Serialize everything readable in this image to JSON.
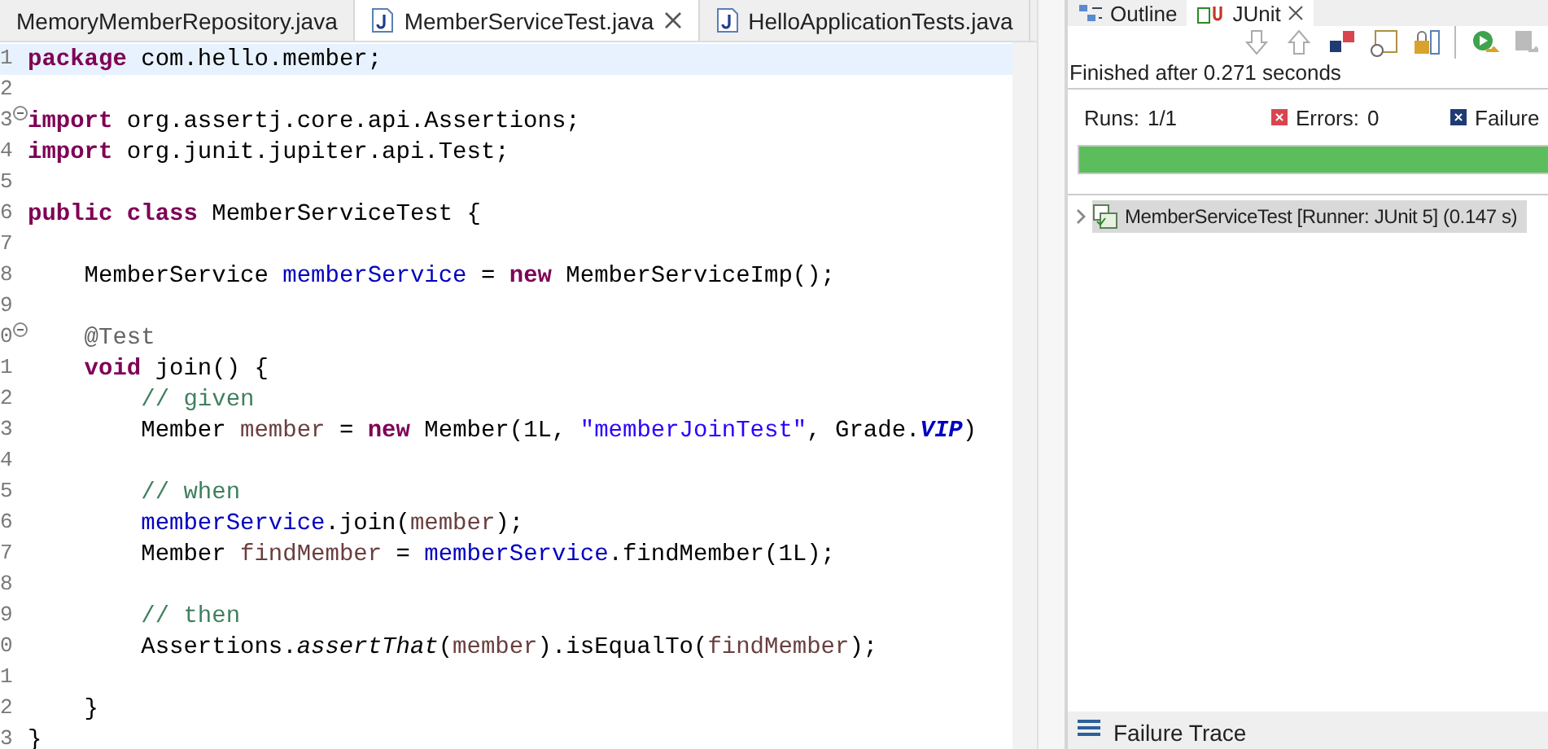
{
  "editor_tabs": [
    {
      "label": "MemoryMemberRepository.java",
      "selected": false,
      "closable": false,
      "icon": false
    },
    {
      "label": "MemberServiceTest.java",
      "selected": true,
      "closable": true,
      "icon": true
    },
    {
      "label": "HelloApplicationTests.java",
      "selected": false,
      "closable": false,
      "icon": true
    }
  ],
  "editor": {
    "lines": [
      {
        "number": "1",
        "fold": false,
        "current": true,
        "segments": [
          {
            "kind": "keyword",
            "text": "package"
          },
          {
            "kind": "plain",
            "text": " com.hello.member;"
          }
        ]
      },
      {
        "number": "2",
        "fold": false,
        "current": false
      },
      {
        "number": "3",
        "fold": true,
        "current": false,
        "segments": [
          {
            "kind": "keyword",
            "text": "import"
          },
          {
            "kind": "plain",
            "text": " org.assertj.core.api.Assertions;"
          }
        ]
      },
      {
        "number": "4",
        "fold": false,
        "current": false,
        "segments": [
          {
            "kind": "keyword",
            "text": "import"
          },
          {
            "kind": "plain",
            "text": " org.junit.jupiter.api.Test;"
          }
        ]
      },
      {
        "number": "5",
        "fold": false,
        "current": false
      },
      {
        "number": "6",
        "fold": false,
        "current": false,
        "segments": [
          {
            "kind": "keyword",
            "text": "public"
          },
          {
            "kind": "keyword",
            "text": " class"
          },
          {
            "kind": "plain",
            "text": " MemberServiceTest {"
          }
        ]
      },
      {
        "number": "7",
        "fold": false,
        "current": false
      },
      {
        "number": "8",
        "fold": false,
        "current": false,
        "segments": [
          {
            "kind": "plain",
            "text": "    MemberService "
          },
          {
            "kind": "field",
            "text": "memberService"
          },
          {
            "kind": "plain",
            "text": " = "
          },
          {
            "kind": "keyword",
            "text": "new"
          },
          {
            "kind": "plain",
            "text": " MemberServiceImp();"
          }
        ]
      },
      {
        "number": "9",
        "fold": false,
        "current": false
      },
      {
        "number": "0",
        "fold": true,
        "current": false,
        "segments": [
          {
            "kind": "annotation",
            "text": "    @Test"
          }
        ]
      },
      {
        "number": "1",
        "fold": false,
        "current": false,
        "segments": [
          {
            "kind": "keyword",
            "text": "    void"
          },
          {
            "kind": "plain",
            "text": " join() {"
          }
        ]
      },
      {
        "number": "2",
        "fold": false,
        "current": false,
        "segments": [
          {
            "kind": "comment",
            "text": "        // given"
          }
        ]
      },
      {
        "number": "3",
        "fold": false,
        "current": false,
        "segments": [
          {
            "kind": "plain",
            "text": "        Member "
          },
          {
            "kind": "local",
            "text": "member"
          },
          {
            "kind": "plain",
            "text": " = "
          },
          {
            "kind": "keyword",
            "text": "new"
          },
          {
            "kind": "plain",
            "text": " Member(1L, "
          },
          {
            "kind": "string",
            "text": "\"memberJoinTest\""
          },
          {
            "kind": "plain",
            "text": ", Grade."
          },
          {
            "kind": "constant",
            "text": "VIP"
          },
          {
            "kind": "plain",
            "text": ")"
          }
        ]
      },
      {
        "number": "4",
        "fold": false,
        "current": false
      },
      {
        "number": "5",
        "fold": false,
        "current": false,
        "segments": [
          {
            "kind": "comment",
            "text": "        // when"
          }
        ]
      },
      {
        "number": "6",
        "fold": false,
        "current": false,
        "segments": [
          {
            "kind": "field",
            "text": "        memberService"
          },
          {
            "kind": "plain",
            "text": ".join("
          },
          {
            "kind": "local",
            "text": "member"
          },
          {
            "kind": "plain",
            "text": ");"
          }
        ]
      },
      {
        "number": "7",
        "fold": false,
        "current": false,
        "segments": [
          {
            "kind": "plain",
            "text": "        Member "
          },
          {
            "kind": "local",
            "text": "findMember"
          },
          {
            "kind": "plain",
            "text": " = "
          },
          {
            "kind": "field",
            "text": "memberService"
          },
          {
            "kind": "plain",
            "text": ".findMember(1L);"
          }
        ]
      },
      {
        "number": "8",
        "fold": false,
        "current": false
      },
      {
        "number": "9",
        "fold": false,
        "current": false,
        "segments": [
          {
            "kind": "comment",
            "text": "        // then"
          }
        ]
      },
      {
        "number": "0",
        "fold": false,
        "current": false,
        "segments": [
          {
            "kind": "plain",
            "text": "        Assertions."
          },
          {
            "kind": "static",
            "text": "assertThat"
          },
          {
            "kind": "plain",
            "text": "("
          },
          {
            "kind": "local",
            "text": "member"
          },
          {
            "kind": "plain",
            "text": ").isEqualTo("
          },
          {
            "kind": "local",
            "text": "findMember"
          },
          {
            "kind": "plain",
            "text": ");"
          }
        ]
      },
      {
        "number": "1",
        "fold": false,
        "current": false
      },
      {
        "number": "2",
        "fold": false,
        "current": false,
        "segments": [
          {
            "kind": "plain",
            "text": "    }"
          }
        ]
      },
      {
        "number": "3",
        "fold": false,
        "current": false,
        "segments": [
          {
            "kind": "plain",
            "text": "}"
          }
        ]
      }
    ]
  },
  "junit": {
    "view_tabs": [
      {
        "label": "Outline",
        "selected": false,
        "kind": "outline"
      },
      {
        "label": "JUnit",
        "selected": true,
        "kind": "junit"
      }
    ],
    "status": "Finished after 0.271 seconds",
    "counters": [
      {
        "kind": "runs",
        "label": "Runs:",
        "value": "1/1"
      },
      {
        "kind": "errors",
        "label": "Errors:",
        "value": "0"
      },
      {
        "kind": "failures",
        "label": "Failure"
      }
    ],
    "progress": {
      "level": 1,
      "failed": false
    },
    "tree": [
      {
        "label": "MemberServiceTest [Runner: JUnit 5] (0.147 s)",
        "expanded": false,
        "selected": true
      }
    ],
    "failure_trace": {
      "title": "Failure Trace"
    }
  }
}
